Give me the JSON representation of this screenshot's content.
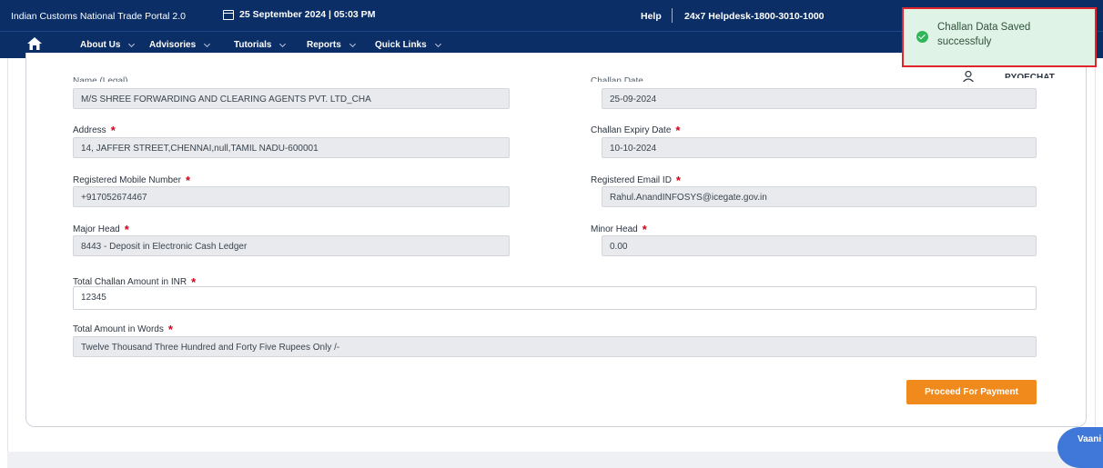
{
  "header": {
    "portal_title": "Indian Customs National Trade Portal 2.0",
    "datetime": "25 September 2024 | 05:03 PM",
    "help_label": "Help",
    "helpdesk_label": "24x7 Helpdesk-1800-3010-1000"
  },
  "nav": {
    "items": [
      {
        "label": "About Us"
      },
      {
        "label": "Advisories"
      },
      {
        "label": "Tutorials"
      },
      {
        "label": "Reports"
      },
      {
        "label": "Quick Links"
      }
    ]
  },
  "user": {
    "name": "PYOECHAT"
  },
  "form": {
    "name_label": "Name (Legal)",
    "name_value": "M/S SHREE FORWARDING AND CLEARING AGENTS PVT. LTD_CHA",
    "challan_date_label": "Challan Date",
    "challan_date_value": "25-09-2024",
    "address_label": "Address",
    "address_value": "14, JAFFER STREET,CHENNAI,null,TAMIL NADU-600001",
    "expiry_label": "Challan Expiry Date",
    "expiry_value": "10-10-2024",
    "mobile_label": "Registered Mobile Number",
    "mobile_value": "+917052674467",
    "email_label": "Registered Email ID",
    "email_value": "Rahul.AnandINFOSYS@icegate.gov.in",
    "major_head_label": "Major Head",
    "major_head_value": "8443 - Deposit in Electronic Cash Ledger",
    "minor_head_label": "Minor Head",
    "minor_head_value": "0.00",
    "total_label": "Total Challan Amount in INR",
    "total_value": "12345",
    "words_label": "Total Amount in Words",
    "words_value": "Twelve Thousand Three Hundred and Forty Five  Rupees Only /-",
    "required_marker": "*",
    "proceed_button": "Proceed For Payment"
  },
  "toast": {
    "message": "Challan Data Saved successfuly"
  },
  "chat": {
    "label": "Vaani"
  },
  "colors": {
    "header_bg": "#0b2e66",
    "accent_orange": "#f08a1c",
    "toast_bg": "#dff3e6",
    "toast_border": "#e0262b",
    "success_green": "#2fb55a",
    "required_red": "#d0021b"
  }
}
